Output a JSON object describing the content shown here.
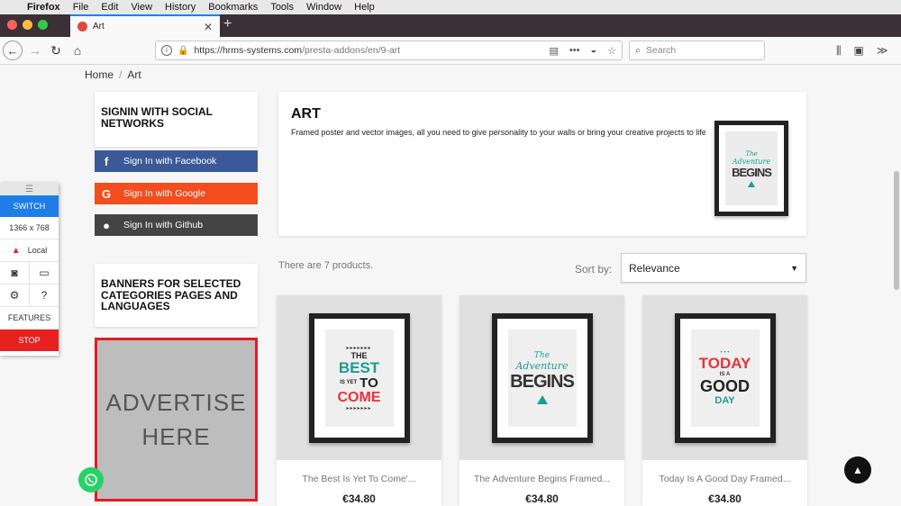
{
  "menubar": {
    "app": "Firefox",
    "items": [
      "File",
      "Edit",
      "View",
      "History",
      "Bookmarks",
      "Tools",
      "Window",
      "Help"
    ]
  },
  "tab": {
    "title": "Art",
    "close": "✕",
    "new": "+"
  },
  "nav": {
    "url_domain": "https://hrms-systems.com",
    "url_path": "/presta-addons/en/9-art",
    "search_placeholder": "Search"
  },
  "breadcrumb": {
    "home": "Home",
    "sep": "/",
    "current": "Art"
  },
  "social": {
    "title": "SIGNIN WITH SOCIAL NETWORKS",
    "facebook": "Sign In with Facebook",
    "google": "Sign In with Google",
    "github": "Sign In with Github"
  },
  "banners": {
    "title": "BANNERS FOR SELECTED CATEGORIES PAGES AND LANGUAGES",
    "ad_line1": "ADVERTISE",
    "ad_line2": "HERE"
  },
  "category": {
    "title": "ART",
    "description": "Framed poster and vector images, all you need to give personality to your walls or bring your creative projects to life."
  },
  "listing": {
    "count_text": "There are 7 products.",
    "sort_label": "Sort by:",
    "sort_value": "Relevance"
  },
  "products": [
    {
      "name": "The Best Is Yet To Come'...",
      "price": "€34.80"
    },
    {
      "name": "The Adventure Begins Framed...",
      "price": "€34.80"
    },
    {
      "name": "Today Is A Good Day Framed...",
      "price": "€34.80"
    }
  ],
  "posters": {
    "best": {
      "l1": "THE",
      "l2": "BEST",
      "l3": "IS YET",
      "l4": "TO",
      "l5": "COME"
    },
    "adventure": {
      "l1": "The",
      "l2": "Adventure",
      "l3": "BEGINS"
    },
    "today": {
      "l1": "TODAY",
      "l2": "IS A",
      "l3": "GOOD",
      "l4": "DAY"
    }
  },
  "widget": {
    "switch": "SWITCH",
    "resolution": "1366 x 768",
    "env": "Local",
    "features": "FEATURES",
    "stop": "STOP"
  },
  "colors": {
    "facebook": "#3b5998",
    "google": "#f24d1d",
    "github": "#444444",
    "accent": "#1e7ee8",
    "stop": "#e82020",
    "teal": "#1a9e93",
    "red": "#e8323c"
  }
}
